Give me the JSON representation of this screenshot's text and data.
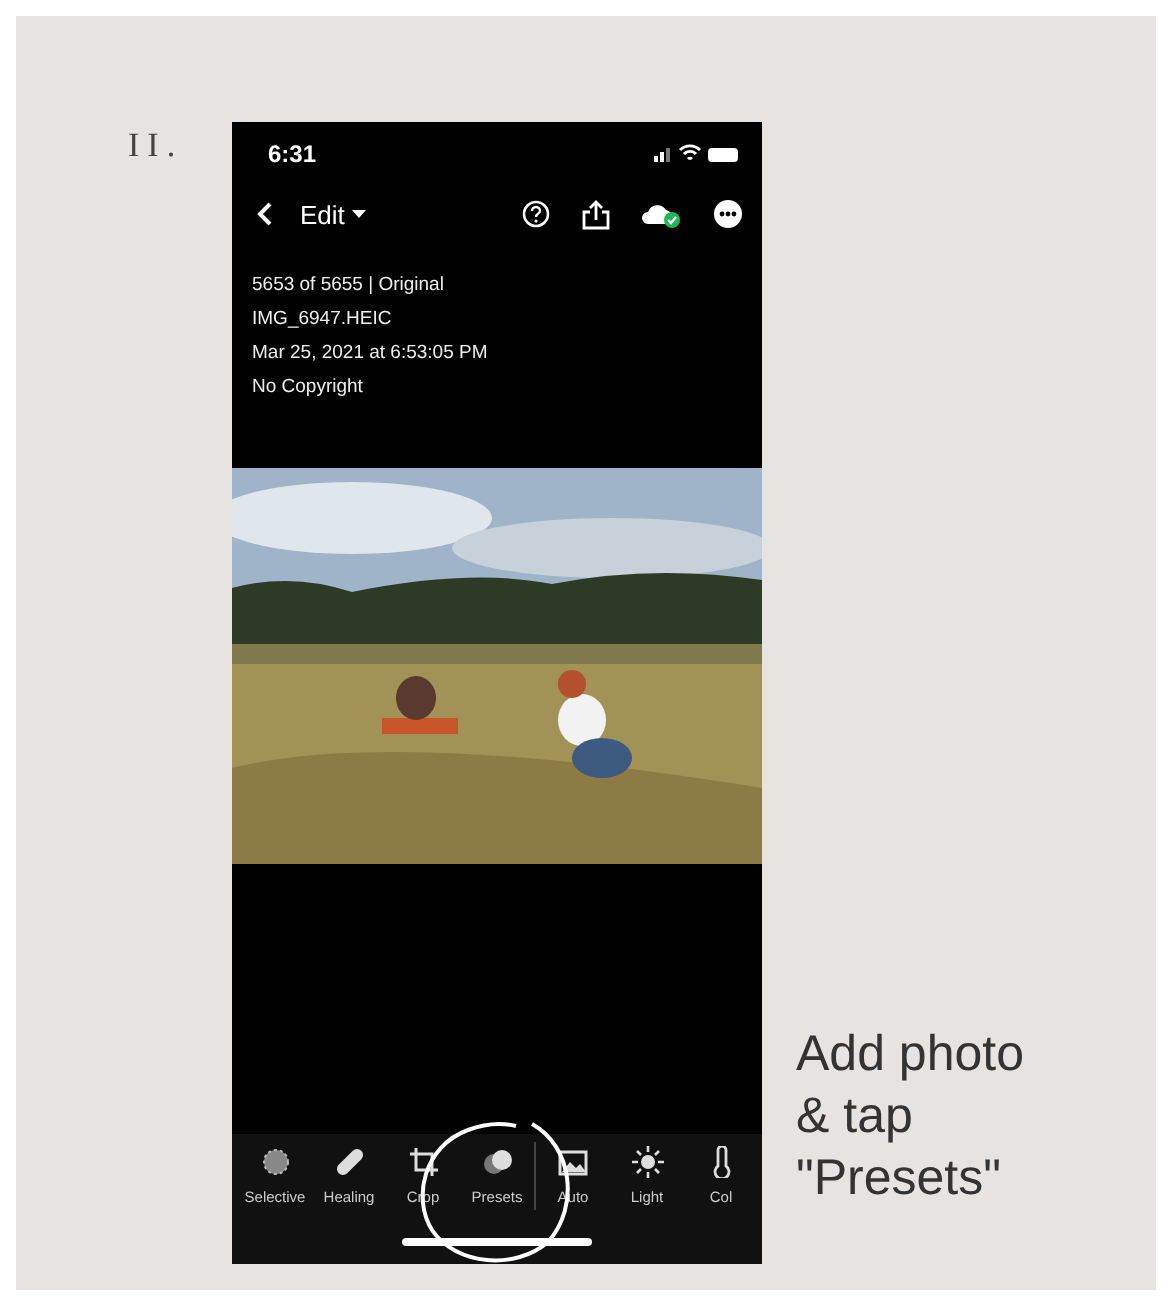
{
  "step": {
    "number": "II."
  },
  "phone": {
    "status_bar": {
      "time": "6:31"
    },
    "header": {
      "title": "Edit"
    },
    "info": [
      "5653 of 5655 | Original",
      "IMG_6947.HEIC",
      "Mar 25, 2021 at 6:53:05 PM",
      "No Copyright"
    ],
    "tools": [
      {
        "label": "Selective",
        "kind": "selective"
      },
      {
        "label": "Healing",
        "kind": "healing"
      },
      {
        "label": "Crop",
        "kind": "crop"
      },
      {
        "label": "Presets",
        "kind": "presets"
      },
      {
        "label": "Auto",
        "kind": "auto"
      },
      {
        "label": "Light",
        "kind": "light"
      },
      {
        "label": "Col",
        "kind": "color"
      }
    ]
  },
  "caption": "Add photo\n& tap\n\"Presets\""
}
